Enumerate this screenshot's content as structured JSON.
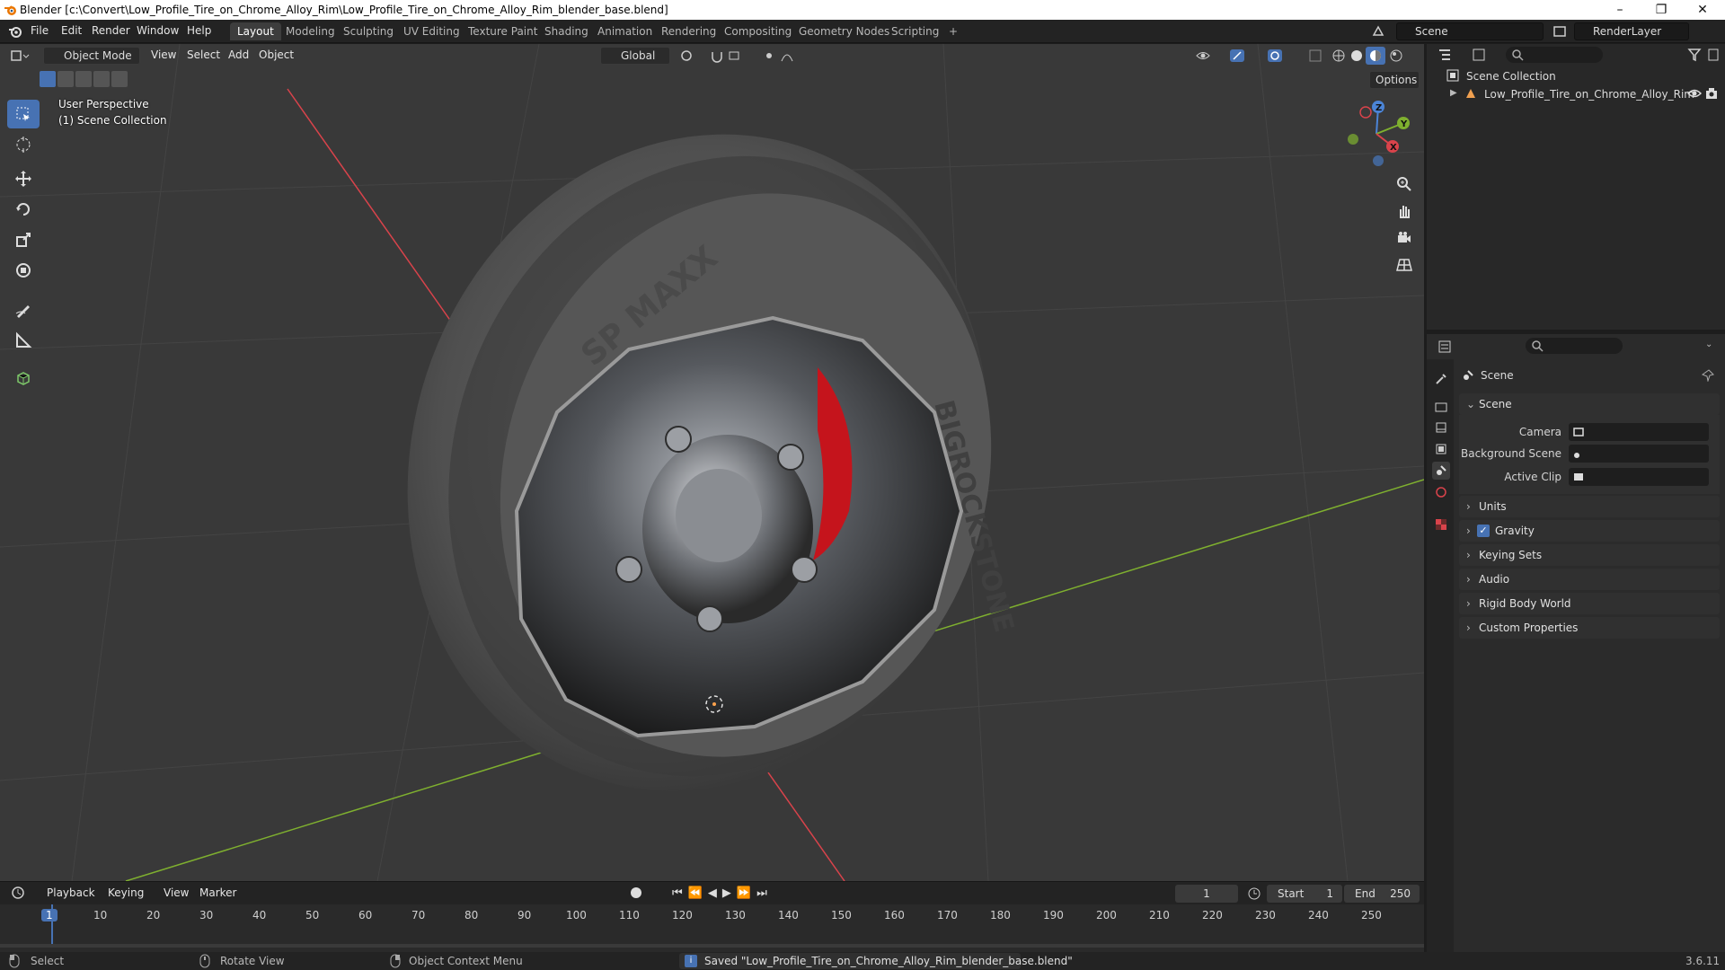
{
  "window": {
    "title": "Blender [c:\\Convert\\Low_Profile_Tire_on_Chrome_Alloy_Rim\\Low_Profile_Tire_on_Chrome_Alloy_Rim_blender_base.blend]",
    "minimize": "–",
    "maximize": "❐",
    "close": "✕"
  },
  "menu": [
    "File",
    "Edit",
    "Render",
    "Window",
    "Help"
  ],
  "workspaces": {
    "tabs": [
      "Layout",
      "Modeling",
      "Sculpting",
      "UV Editing",
      "Texture Paint",
      "Shading",
      "Animation",
      "Rendering",
      "Compositing",
      "Geometry Nodes",
      "Scripting"
    ],
    "active": "Layout",
    "add": "+"
  },
  "scene_selector": {
    "value": "Scene"
  },
  "render_layer": {
    "value": "RenderLayer"
  },
  "viewport_header": {
    "mode": "Object Mode",
    "menus": [
      "View",
      "Select",
      "Add",
      "Object"
    ],
    "orientation": "Global",
    "options": "Options"
  },
  "viewport_overlay": {
    "line1": "User Perspective",
    "line2": "(1) Scene Collection"
  },
  "tire_text": {
    "brand": "BIGROCKSTONE",
    "model": "SP MAXX"
  },
  "gizmo": {
    "z": "Z",
    "y": "Y",
    "x": "X"
  },
  "outliner": {
    "root": "Scene Collection",
    "items": [
      {
        "label": "Low_Profile_Tire_on_Chrome_Alloy_Rim"
      }
    ]
  },
  "properties": {
    "header": "Scene",
    "panel": "Scene",
    "fields": [
      {
        "label": "Camera",
        "value": ""
      },
      {
        "label": "Background Scene",
        "value": ""
      },
      {
        "label": "Active Clip",
        "value": ""
      }
    ],
    "sections": [
      "Units",
      "Gravity",
      "Keying Sets",
      "Audio",
      "Rigid Body World",
      "Custom Properties"
    ],
    "gravity_checked": true
  },
  "timeline": {
    "menus": [
      "Playback",
      "Keying",
      "View",
      "Marker"
    ],
    "current_frame": "1",
    "start_label": "Start",
    "start": "1",
    "end_label": "End",
    "end": "250",
    "ticks": [
      "1",
      "10",
      "20",
      "30",
      "40",
      "50",
      "60",
      "70",
      "80",
      "90",
      "100",
      "110",
      "120",
      "130",
      "140",
      "150",
      "160",
      "170",
      "180",
      "190",
      "200",
      "210",
      "220",
      "230",
      "240",
      "250"
    ]
  },
  "statusbar": {
    "select": "Select",
    "rotate": "Rotate View",
    "context": "Object Context Menu",
    "message": "Saved \"Low_Profile_Tire_on_Chrome_Alloy_Rim_blender_base.blend\"",
    "version": "3.6.11"
  },
  "colors": {
    "accent": "#4772b3",
    "x_axis": "#d9434b",
    "y_axis": "#7fb02f",
    "z_axis": "#4b84d6",
    "caliper": "#c5141c"
  }
}
